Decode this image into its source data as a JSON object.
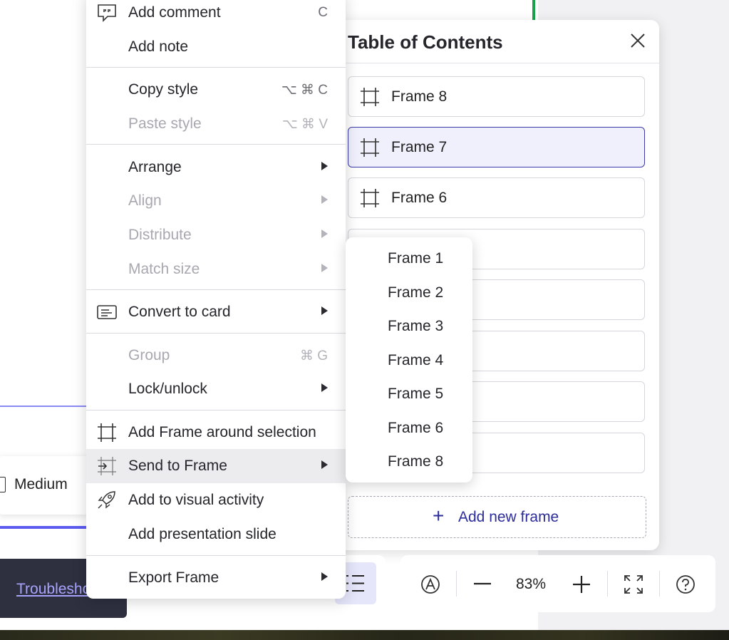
{
  "colors": {
    "accent": "#2d2d9c",
    "selected_border": "#3c3ca8",
    "selected_bg": "#f0f0fd",
    "frame_edge": "#5b5bf0",
    "toast_bg": "#2e3040",
    "link": "#a7a3ff"
  },
  "canvas": {
    "medium_label": "Medium",
    "troubleshoot_link": "Troubleshoot"
  },
  "context_menu": {
    "items": [
      {
        "label": "Add comment",
        "shortcut": "C",
        "icon": "comment-icon"
      },
      {
        "label": "Add note"
      },
      {
        "label": "Copy style",
        "shortcut": "⌥ ⌘ C"
      },
      {
        "label": "Paste style",
        "shortcut": "⌥ ⌘ V",
        "disabled": true
      },
      {
        "label": "Arrange",
        "submenu": true
      },
      {
        "label": "Align",
        "submenu": true,
        "disabled": true
      },
      {
        "label": "Distribute",
        "submenu": true,
        "disabled": true
      },
      {
        "label": "Match size",
        "submenu": true,
        "disabled": true
      },
      {
        "label": "Convert to card",
        "submenu": true,
        "icon": "card-icon"
      },
      {
        "label": "Group",
        "shortcut": "⌘ G",
        "disabled": true
      },
      {
        "label": "Lock/unlock",
        "submenu": true
      },
      {
        "label": "Add Frame around selection",
        "icon": "frame-icon"
      },
      {
        "label": "Send to Frame",
        "submenu": true,
        "icon": "send-to-frame-icon",
        "hovered": true
      },
      {
        "label": "Add to visual activity",
        "icon": "rocket-icon"
      },
      {
        "label": "Add presentation slide"
      },
      {
        "label": "Export Frame",
        "submenu": true
      }
    ]
  },
  "send_to_frame_submenu": {
    "items": [
      "Frame 1",
      "Frame 2",
      "Frame 3",
      "Frame 4",
      "Frame 5",
      "Frame 6",
      "Frame 8"
    ]
  },
  "toc_panel": {
    "title": "Table of Contents",
    "frames": [
      {
        "label": "Frame 8",
        "selected": false
      },
      {
        "label": "Frame 7",
        "selected": true
      },
      {
        "label": "Frame 6",
        "selected": false
      }
    ],
    "add_new_frame_label": "Add new frame"
  },
  "bottom_toolbar": {
    "zoom_value": "83%"
  }
}
